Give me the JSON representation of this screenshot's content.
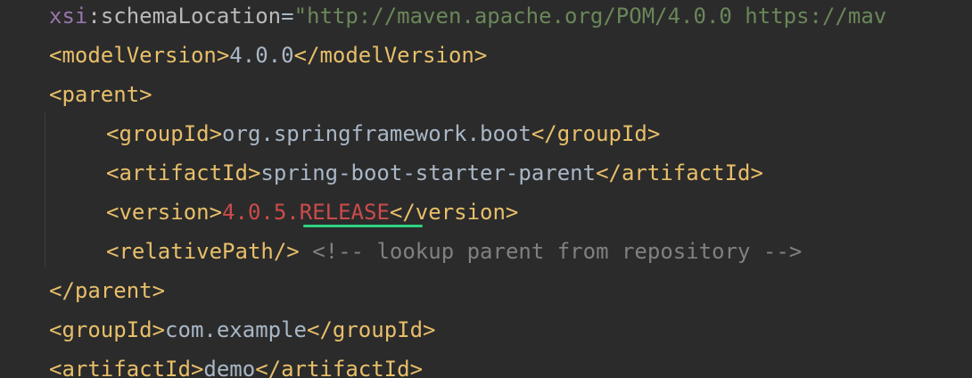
{
  "code": {
    "line1": {
      "ns": "xsi",
      "colon": ":",
      "attr": "schemaLocation",
      "eq": "=",
      "value": "\"http://maven.apache.org/POM/4.0.0 https://mav"
    },
    "line2": {
      "open": "<modelVersion>",
      "text": "4.0.0",
      "close": "</modelVersion>"
    },
    "line3": {
      "open": "<parent>"
    },
    "line4": {
      "open": "<groupId>",
      "text": "org.springframework.boot",
      "close": "</groupId>"
    },
    "line5": {
      "open": "<artifactId>",
      "text": "spring-boot-starter-parent",
      "close": "</artifactId>"
    },
    "line6": {
      "open": "<version>",
      "text": "4.0.5.RELEASE",
      "close": "</version>"
    },
    "line7": {
      "tag": "<relativePath/>",
      "comment": " <!-- lookup parent from repository -->"
    },
    "line8": {
      "close": "</parent>"
    },
    "line9": {
      "open": "<groupId>",
      "text": "com.example",
      "close": "</groupId>"
    },
    "line10": {
      "open": "<artifactId>",
      "text": "demo",
      "close": "</artifactId>"
    }
  },
  "colors": {
    "background": "#2b2b2b",
    "tag": "#e8bf6a",
    "text": "#a9b7c6",
    "string": "#6a8759",
    "comment": "#808080",
    "error": "#cc4b4b",
    "squiggle": "#2fd27d"
  }
}
